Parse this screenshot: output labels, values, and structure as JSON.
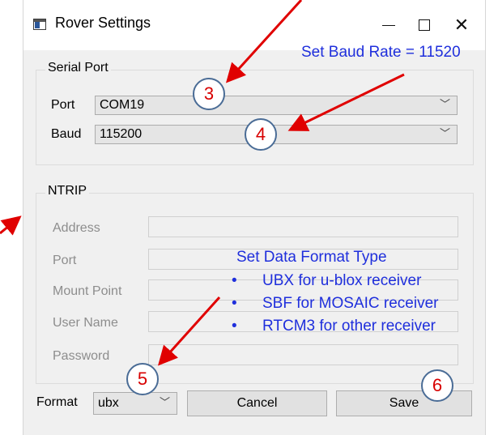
{
  "window": {
    "title": "Rover Settings",
    "controls": {
      "minimize": "",
      "maximize": "",
      "close": "✕"
    }
  },
  "serial_port": {
    "title": "Serial Port",
    "port_label": "Port",
    "port_value": "COM19",
    "baud_label": "Baud",
    "baud_value": "115200"
  },
  "ntrip": {
    "title": "NTRIP",
    "fields": [
      {
        "label": "Address"
      },
      {
        "label": "Port"
      },
      {
        "label": "Mount Point"
      },
      {
        "label": "User Name"
      },
      {
        "label": "Password"
      }
    ]
  },
  "footer": {
    "format_label": "Format",
    "format_value": "ubx",
    "cancel_label": "Cancel",
    "save_label": "Save"
  },
  "annotations": {
    "baud_note": "Set Baud Rate = 11520",
    "format_note": "Set Data Format Type",
    "format_bullets": [
      "UBX for u-blox receiver",
      "SBF for MOSAIC receiver",
      "RTCM3 for other receiver"
    ],
    "bullet_char": "•",
    "steps": [
      "3",
      "4",
      "5",
      "6"
    ]
  },
  "colors": {
    "annotation_text": "#1f2fdc",
    "arrow": "#e00000",
    "step_number": "#d80000",
    "step_circle_border": "#4a6c96"
  }
}
